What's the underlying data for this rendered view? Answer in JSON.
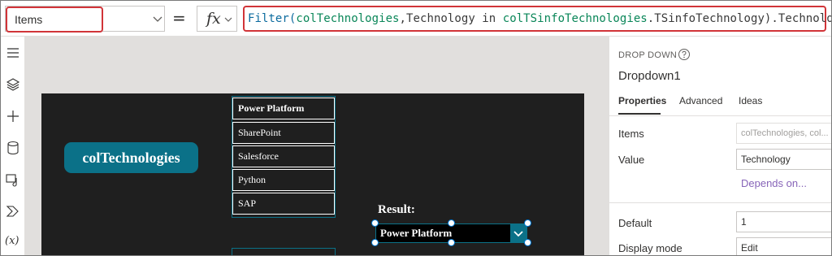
{
  "formula_bar": {
    "property_value": "Items",
    "equals": "=",
    "fx": "fx",
    "formula": {
      "fn_filter": "Filter(",
      "arg1": "colTechnologies",
      "sep1": ",Technology in ",
      "arg2": "colTSinfoTechnologies",
      "tail": ".TSinfoTechnology).Technology"
    }
  },
  "left_rail": {
    "icons": [
      "hamburger-menu-icon",
      "layers-icon",
      "plus-icon",
      "database-icon",
      "media-icon",
      "power-automate-icon",
      "variables-icon"
    ],
    "variables_label": "(x)"
  },
  "canvas": {
    "pill_label": "colTechnologies",
    "gallery_items": [
      "Power Platform",
      "SharePoint",
      "Salesforce",
      "Python",
      "SAP"
    ],
    "result_label": "Result:",
    "dropdown_value": "Power Platform",
    "accent_color": "#0b7188"
  },
  "right_panel": {
    "control_type": "DROP DOWN",
    "control_name": "Dropdown1",
    "tabs": [
      "Properties",
      "Advanced",
      "Ideas"
    ],
    "items_label": "Items",
    "items_value": "colTechnologies, col...",
    "value_label": "Value",
    "value_value": "Technology",
    "depends_on": "Depends on...",
    "default_label": "Default",
    "default_value": "1",
    "display_mode_label": "Display mode",
    "display_mode_value": "Edit"
  }
}
